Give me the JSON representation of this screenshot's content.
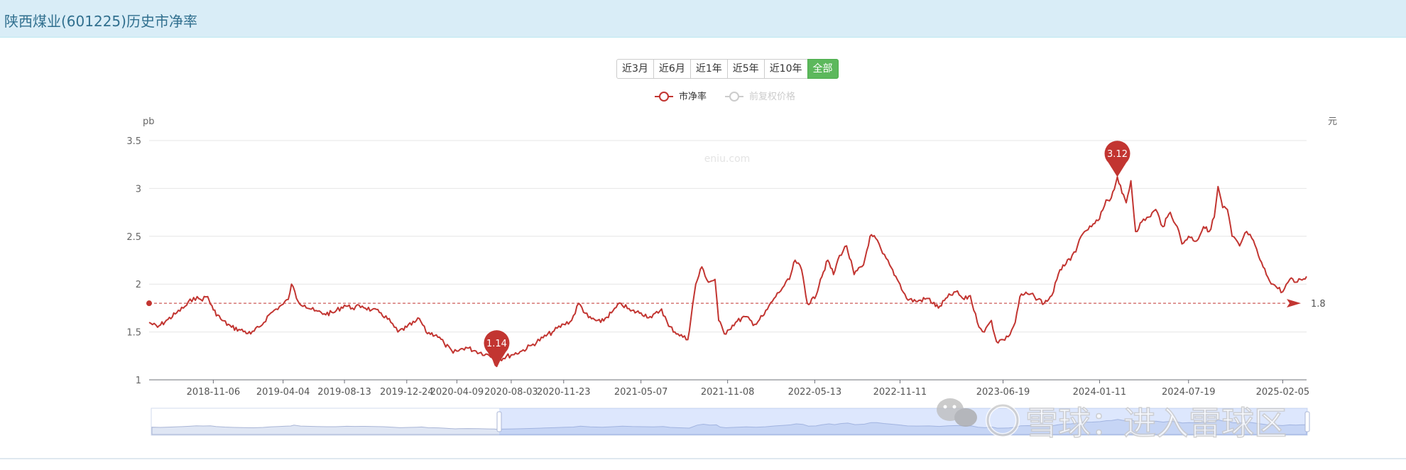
{
  "header": {
    "title": "陕西煤业(601225)历史市净率"
  },
  "range_buttons": [
    "近3月",
    "近6月",
    "近1年",
    "近5年",
    "近10年",
    "全部"
  ],
  "active_range": "全部",
  "watermark": "eniu.com",
  "overlay_watermark": "雪球：进入雷球区",
  "chart_data": {
    "type": "line",
    "series": [
      {
        "name": "市净率",
        "color": "#c23531"
      },
      {
        "name": "前复权价格",
        "color": "#cccccc",
        "hidden": true
      }
    ],
    "y_left_label": "pb",
    "y_right_label": "元",
    "yticks": [
      "1",
      "1.5",
      "2",
      "2.5",
      "3",
      "3.5"
    ],
    "ylim": [
      1,
      3.5
    ],
    "xlim": [
      "2018-06-22",
      "2025-03-28"
    ],
    "xticks": [
      "2018-11-06",
      "2019-04-04",
      "2019-08-13",
      "2019-12-24",
      "2020-04-09",
      "2020-08-03",
      "2020-11-23",
      "2021-05-07",
      "2021-11-08",
      "2022-05-13",
      "2022-11-11",
      "2023-06-19",
      "2024-01-11",
      "2024-07-19",
      "2025-02-05"
    ],
    "points": [
      [
        "2018-06-22",
        1.6
      ],
      [
        "2018-07-10",
        1.55
      ],
      [
        "2018-08-01",
        1.63
      ],
      [
        "2018-08-20",
        1.7
      ],
      [
        "2018-09-10",
        1.78
      ],
      [
        "2018-09-25",
        1.86
      ],
      [
        "2018-10-10",
        1.84
      ],
      [
        "2018-10-25",
        1.87
      ],
      [
        "2018-11-06",
        1.73
      ],
      [
        "2018-11-25",
        1.62
      ],
      [
        "2018-12-15",
        1.55
      ],
      [
        "2019-01-03",
        1.52
      ],
      [
        "2019-01-25",
        1.48
      ],
      [
        "2019-02-15",
        1.56
      ],
      [
        "2019-03-05",
        1.68
      ],
      [
        "2019-03-20",
        1.74
      ],
      [
        "2019-04-04",
        1.79
      ],
      [
        "2019-04-15",
        1.84
      ],
      [
        "2019-04-22",
        2.0
      ],
      [
        "2019-05-06",
        1.82
      ],
      [
        "2019-05-20",
        1.78
      ],
      [
        "2019-06-10",
        1.72
      ],
      [
        "2019-07-01",
        1.69
      ],
      [
        "2019-07-20",
        1.7
      ],
      [
        "2019-08-13",
        1.78
      ],
      [
        "2019-08-30",
        1.75
      ],
      [
        "2019-09-20",
        1.77
      ],
      [
        "2019-10-10",
        1.73
      ],
      [
        "2019-10-30",
        1.7
      ],
      [
        "2019-11-20",
        1.6
      ],
      [
        "2019-12-05",
        1.5
      ],
      [
        "2019-12-24",
        1.55
      ],
      [
        "2020-01-10",
        1.6
      ],
      [
        "2020-01-20",
        1.64
      ],
      [
        "2020-02-03",
        1.5
      ],
      [
        "2020-02-25",
        1.47
      ],
      [
        "2020-03-13",
        1.38
      ],
      [
        "2020-04-01",
        1.28
      ],
      [
        "2020-04-09",
        1.3
      ],
      [
        "2020-04-28",
        1.34
      ],
      [
        "2020-05-20",
        1.3
      ],
      [
        "2020-06-10",
        1.27
      ],
      [
        "2020-06-24",
        1.24
      ],
      [
        "2020-07-03",
        1.14
      ],
      [
        "2020-07-10",
        1.22
      ],
      [
        "2020-08-03",
        1.26
      ],
      [
        "2020-08-25",
        1.3
      ],
      [
        "2020-09-15",
        1.36
      ],
      [
        "2020-10-10",
        1.44
      ],
      [
        "2020-10-30",
        1.5
      ],
      [
        "2020-11-23",
        1.58
      ],
      [
        "2020-12-10",
        1.62
      ],
      [
        "2020-12-25",
        1.8
      ],
      [
        "2021-01-15",
        1.65
      ],
      [
        "2021-02-10",
        1.6
      ],
      [
        "2021-03-05",
        1.7
      ],
      [
        "2021-03-25",
        1.8
      ],
      [
        "2021-04-15",
        1.72
      ],
      [
        "2021-05-07",
        1.7
      ],
      [
        "2021-05-30",
        1.65
      ],
      [
        "2021-06-20",
        1.74
      ],
      [
        "2021-07-05",
        1.56
      ],
      [
        "2021-07-25",
        1.48
      ],
      [
        "2021-08-15",
        1.42
      ],
      [
        "2021-09-01",
        2.0
      ],
      [
        "2021-09-14",
        2.18
      ],
      [
        "2021-09-28",
        2.02
      ],
      [
        "2021-10-12",
        2.05
      ],
      [
        "2021-10-20",
        1.62
      ],
      [
        "2021-11-01",
        1.48
      ],
      [
        "2021-11-08",
        1.52
      ],
      [
        "2021-11-25",
        1.6
      ],
      [
        "2021-12-15",
        1.66
      ],
      [
        "2022-01-05",
        1.58
      ],
      [
        "2022-01-25",
        1.68
      ],
      [
        "2022-02-15",
        1.85
      ],
      [
        "2022-03-05",
        1.96
      ],
      [
        "2022-03-20",
        2.05
      ],
      [
        "2022-04-01",
        2.25
      ],
      [
        "2022-04-15",
        2.15
      ],
      [
        "2022-04-27",
        1.8
      ],
      [
        "2022-05-13",
        1.85
      ],
      [
        "2022-05-25",
        2.05
      ],
      [
        "2022-06-10",
        2.25
      ],
      [
        "2022-06-22",
        2.1
      ],
      [
        "2022-07-05",
        2.3
      ],
      [
        "2022-07-20",
        2.4
      ],
      [
        "2022-08-05",
        2.1
      ],
      [
        "2022-08-25",
        2.2
      ],
      [
        "2022-09-08",
        2.5
      ],
      [
        "2022-09-20",
        2.48
      ],
      [
        "2022-10-05",
        2.32
      ],
      [
        "2022-10-20",
        2.2
      ],
      [
        "2022-11-05",
        2.05
      ],
      [
        "2022-11-11",
        2.0
      ],
      [
        "2022-11-25",
        1.85
      ],
      [
        "2022-12-15",
        1.82
      ],
      [
        "2023-01-10",
        1.85
      ],
      [
        "2023-02-01",
        1.75
      ],
      [
        "2023-02-20",
        1.86
      ],
      [
        "2023-03-10",
        1.92
      ],
      [
        "2023-03-28",
        1.84
      ],
      [
        "2023-04-10",
        1.88
      ],
      [
        "2023-04-25",
        1.6
      ],
      [
        "2023-05-10",
        1.5
      ],
      [
        "2023-05-25",
        1.62
      ],
      [
        "2023-06-05",
        1.4
      ],
      [
        "2023-06-19",
        1.42
      ],
      [
        "2023-06-30",
        1.45
      ],
      [
        "2023-07-15",
        1.6
      ],
      [
        "2023-07-25",
        1.87
      ],
      [
        "2023-08-10",
        1.9
      ],
      [
        "2023-08-25",
        1.87
      ],
      [
        "2023-09-15",
        1.8
      ],
      [
        "2023-10-01",
        1.88
      ],
      [
        "2023-10-12",
        2.05
      ],
      [
        "2023-10-25",
        2.2
      ],
      [
        "2023-11-10",
        2.25
      ],
      [
        "2023-11-25",
        2.4
      ],
      [
        "2023-12-10",
        2.55
      ],
      [
        "2023-12-25",
        2.6
      ],
      [
        "2024-01-11",
        2.68
      ],
      [
        "2024-01-25",
        2.88
      ],
      [
        "2024-02-05",
        2.9
      ],
      [
        "2024-02-18",
        3.12
      ],
      [
        "2024-02-28",
        2.95
      ],
      [
        "2024-03-08",
        2.85
      ],
      [
        "2024-03-18",
        3.08
      ],
      [
        "2024-03-28",
        2.55
      ],
      [
        "2024-04-10",
        2.65
      ],
      [
        "2024-04-25",
        2.7
      ],
      [
        "2024-05-10",
        2.78
      ],
      [
        "2024-05-25",
        2.6
      ],
      [
        "2024-06-10",
        2.75
      ],
      [
        "2024-06-25",
        2.6
      ],
      [
        "2024-07-05",
        2.42
      ],
      [
        "2024-07-19",
        2.5
      ],
      [
        "2024-08-05",
        2.45
      ],
      [
        "2024-08-20",
        2.6
      ],
      [
        "2024-09-01",
        2.55
      ],
      [
        "2024-09-12",
        2.7
      ],
      [
        "2024-09-20",
        3.02
      ],
      [
        "2024-09-30",
        2.8
      ],
      [
        "2024-10-10",
        2.78
      ],
      [
        "2024-10-20",
        2.5
      ],
      [
        "2024-11-05",
        2.4
      ],
      [
        "2024-11-20",
        2.55
      ],
      [
        "2024-12-01",
        2.48
      ],
      [
        "2024-12-15",
        2.3
      ],
      [
        "2025-01-01",
        2.1
      ],
      [
        "2025-01-15",
        2.0
      ],
      [
        "2025-02-05",
        1.92
      ],
      [
        "2025-02-20",
        2.05
      ],
      [
        "2025-03-05",
        2.02
      ],
      [
        "2025-03-15",
        2.05
      ],
      [
        "2025-03-28",
        2.08
      ]
    ],
    "mark_points": [
      {
        "date": "2020-07-03",
        "value": 1.14,
        "label": "1.14"
      },
      {
        "date": "2024-02-18",
        "value": 3.12,
        "label": "3.12"
      }
    ],
    "mark_line": {
      "value": 1.8,
      "label": "1.8"
    },
    "grid": true,
    "legend_position": "top"
  }
}
